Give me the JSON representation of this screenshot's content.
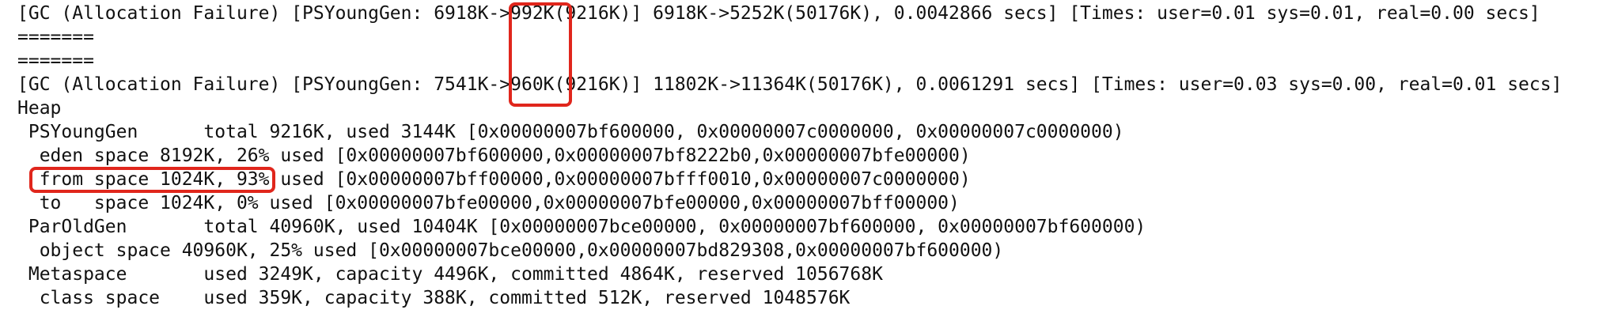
{
  "terminal": {
    "lines": [
      "[GC (Allocation Failure) [PSYoungGen: 6918K->992K(9216K)] 6918K->5252K(50176K), 0.0042866 secs] [Times: user=0.01 sys=0.01, real=0.00 secs]",
      "=======",
      "=======",
      "[GC (Allocation Failure) [PSYoungGen: 7541K->960K(9216K)] 11802K->11364K(50176K), 0.0061291 secs] [Times: user=0.03 sys=0.00, real=0.01 secs]",
      "Heap",
      " PSYoungGen      total 9216K, used 3144K [0x00000007bf600000, 0x00000007c0000000, 0x00000007c0000000)",
      "  eden space 8192K, 26% used [0x00000007bf600000,0x00000007bf8222b0,0x00000007bfe00000)",
      "  from space 1024K, 93% used [0x00000007bff00000,0x00000007bfff0010,0x00000007c0000000)",
      "  to   space 1024K, 0% used [0x00000007bfe00000,0x00000007bfe00000,0x00000007bff00000)",
      " ParOldGen       total 40960K, used 10404K [0x00000007bce00000, 0x00000007bf600000, 0x00000007bf600000)",
      "  object space 40960K, 25% used [0x00000007bce00000,0x00000007bd829308,0x00000007bf600000)",
      " Metaspace       used 3249K, capacity 4496K, committed 4864K, reserved 1056768K",
      "  class space    used 359K, capacity 388K, committed 512K, reserved 1048576K"
    ]
  },
  "annotations": {
    "color": "#e0261c"
  }
}
